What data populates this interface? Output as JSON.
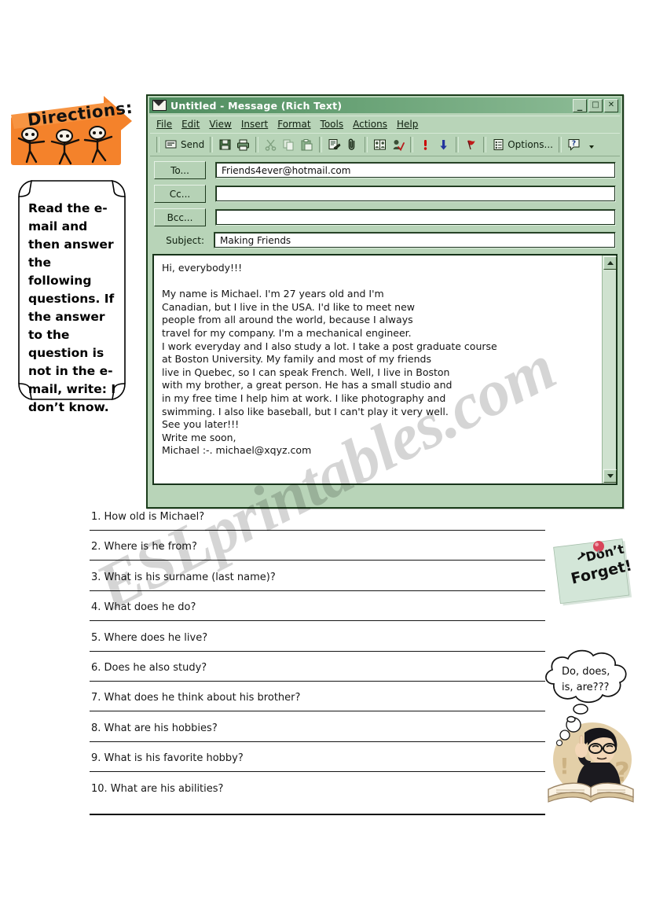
{
  "watermark": {
    "text": "ESLprintables.com"
  },
  "directions": {
    "banner_label": "Directions:",
    "banner_icon": "arrow-banner-with-running-stick-figures",
    "body": "Read the e-mail and then answer the following questions. If the answer to the question is not in the e-mail, write: I don’t know."
  },
  "mail_window": {
    "title": "Untitled - Message (Rich Text)",
    "title_icon": "envelope-icon",
    "window_buttons": [
      {
        "name": "minimize",
        "glyph": "_"
      },
      {
        "name": "maximize",
        "glyph": "□"
      },
      {
        "name": "close",
        "glyph": "✕"
      }
    ],
    "menus": [
      {
        "label": "File",
        "accel": "F"
      },
      {
        "label": "Edit",
        "accel": "E"
      },
      {
        "label": "View",
        "accel": "V"
      },
      {
        "label": "Insert",
        "accel": "I"
      },
      {
        "label": "Format",
        "accel": "o"
      },
      {
        "label": "Tools",
        "accel": "T"
      },
      {
        "label": "Actions",
        "accel": "A"
      },
      {
        "label": "Help",
        "accel": "H"
      }
    ],
    "toolbar": [
      {
        "icon": "send-icon",
        "label": "Send"
      },
      {
        "icon": "save-icon",
        "label": ""
      },
      {
        "icon": "print-icon",
        "label": ""
      },
      {
        "icon": "cut-scissors-icon",
        "label": ""
      },
      {
        "icon": "copy-icon",
        "label": ""
      },
      {
        "icon": "paste-icon",
        "label": ""
      },
      {
        "icon": "insert-file-icon",
        "label": ""
      },
      {
        "icon": "paperclip-attach-icon",
        "label": ""
      },
      {
        "icon": "address-book-icon",
        "label": ""
      },
      {
        "icon": "check-names-icon",
        "label": ""
      },
      {
        "icon": "importance-high-icon",
        "label": ""
      },
      {
        "icon": "importance-low-icon",
        "label": ""
      },
      {
        "icon": "flag-icon",
        "label": ""
      },
      {
        "icon": "options-icon",
        "label": "Options..."
      },
      {
        "icon": "help-icon",
        "label": ""
      },
      {
        "icon": "toolbar-overflow-chevron-icon",
        "label": ""
      }
    ],
    "fields": {
      "to_label": "To...",
      "to_value": "Friends4ever@hotmail.com",
      "cc_label": "Cc...",
      "cc_value": "",
      "bcc_label": "Bcc...",
      "bcc_value": "",
      "subject_label": "Subject:",
      "subject_value": "Making Friends"
    },
    "body_text": "Hi, everybody!!!\n\nMy name is Michael. I'm 27 years old and I'm\nCanadian, but I live in the USA. I'd like to meet new\npeople from all around the world, because I always\ntravel for my company. I'm a mechanical engineer.\nI work everyday and I also study a lot. I take a post graduate course\nat Boston University. My family and most of my friends\nlive in Quebec, so I can speak French. Well, I live in Boston\nwith my brother, a great person. He has a small studio and\nin my free time I help him at work. I like photography and\nswimming. I also like baseball, but I can't play it very well.\nSee you later!!!\nWrite me soon,\nMichael :-. michael@xqyz.com"
  },
  "questions": [
    "1. How old is Michael?",
    "2. Where is he from?",
    "3. What is his surname (last name)?",
    "4. What does he do?",
    "5. Where does he live?",
    "6. Does he also study?",
    "7. What does he think about his brother?",
    "8. What are his hobbies?",
    "9. What is his favorite hobby?",
    "10. What are his abilities?"
  ],
  "sticky_note": {
    "line1": "Don’t",
    "line2": "Forget!",
    "icon": "pushpin-icon"
  },
  "thought_bubble": {
    "line1": "Do, does,",
    "line2": "is, are???"
  },
  "thinker": {
    "icon": "thinking-man-with-book-icon"
  },
  "colors": {
    "window_green": "#b8d4b8",
    "title_green_dark": "#4e8b5e",
    "title_green_light": "#8fbd98",
    "banner_orange": "#f47b20",
    "sticky_green": "#cfe4d4",
    "accent_red": "#cc0000",
    "accent_blue": "#2233aa"
  }
}
